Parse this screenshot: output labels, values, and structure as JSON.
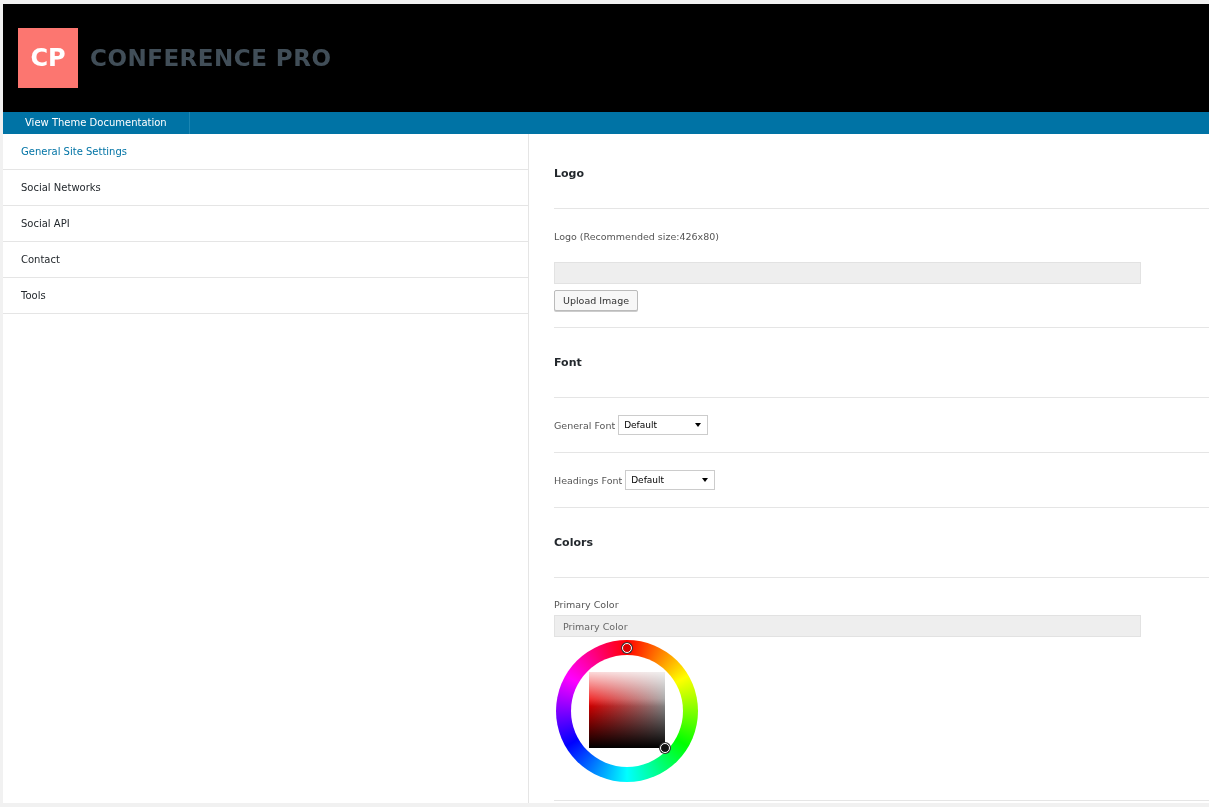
{
  "header": {
    "logo_mark": "CP",
    "title": "CONFERENCE PRO"
  },
  "nav": {
    "items": [
      {
        "label": "View Theme Documentation"
      }
    ]
  },
  "sidebar": {
    "items": [
      {
        "label": "General Site Settings",
        "selected": true
      },
      {
        "label": "Social Networks",
        "selected": false
      },
      {
        "label": "Social API",
        "selected": false
      },
      {
        "label": "Contact",
        "selected": false
      },
      {
        "label": "Tools",
        "selected": false
      }
    ]
  },
  "settings": [
    {
      "kind": "heading",
      "label": "Logo"
    },
    {
      "kind": "upload",
      "label": "Logo (Recommended size:426x80)",
      "button": "Upload Image"
    },
    {
      "kind": "heading",
      "label": "Font"
    },
    {
      "kind": "select",
      "label": "General Font",
      "value": "Default"
    },
    {
      "kind": "select",
      "label": "Headings Font",
      "value": "Default"
    },
    {
      "kind": "heading",
      "label": "Colors"
    },
    {
      "kind": "color",
      "label": "Primary Color",
      "placeholder": "Primary Color"
    }
  ]
}
